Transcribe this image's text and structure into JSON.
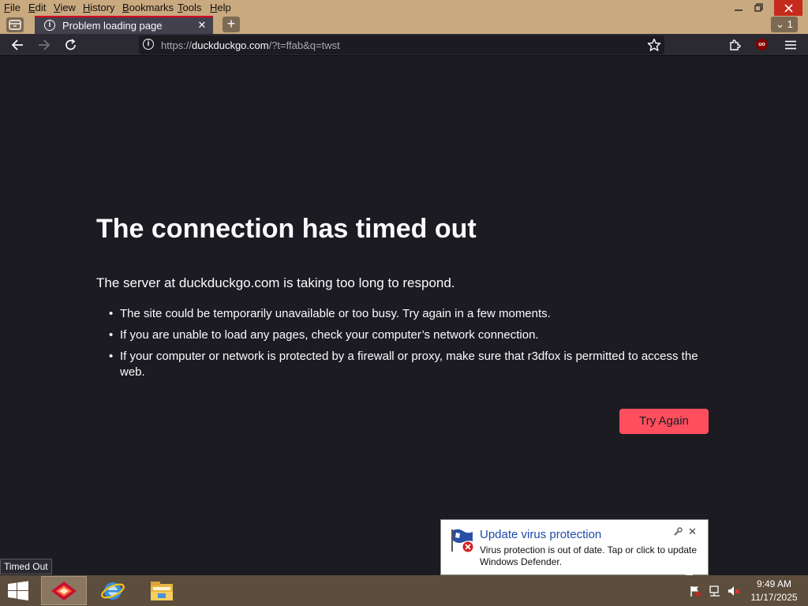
{
  "menubar": {
    "items": [
      "File",
      "Edit",
      "View",
      "History",
      "Bookmarks",
      "Tools",
      "Help"
    ]
  },
  "window_controls": {
    "minimize": "—",
    "restore": "❐",
    "close": "✕"
  },
  "tabstrip": {
    "active_tab_title": "Problem loading page",
    "tab_close": "✕",
    "new_tab": "+",
    "tab_count": "1",
    "tab_list_chevron": "⌄"
  },
  "navbar": {
    "url_scheme": "https://",
    "url_host": "duckduckgo.com",
    "url_rest": "/?t=ffab&q=twst",
    "ublock_label": "uo"
  },
  "error_page": {
    "title": "The connection has timed out",
    "message": "The server at duckduckgo.com is taking too long to respond.",
    "list": [
      "The site could be temporarily unavailable or too busy. Try again in a few moments.",
      "If you are unable to load any pages, check your computer’s network connection.",
      "If your computer or network is protected by a firewall or proxy, make sure that r3dfox is permitted to access the web."
    ],
    "try_again_label": "Try Again"
  },
  "status": {
    "text": "Timed Out"
  },
  "balloon": {
    "title": "Update virus protection",
    "text": "Virus protection is out of date. Tap or click to update Windows Defender.",
    "close": "✕"
  },
  "taskbar": {
    "time": "9:49 AM",
    "date": "11/17/2025"
  },
  "colors": {
    "page_background": "#1c1b22",
    "titlebar": "#c9a97f",
    "try_again_button": "#ff4f5e",
    "tab_accent": "#d70022",
    "taskbar": "#5c4d3c"
  },
  "icons": {
    "back": "arrow-left-icon",
    "forward": "arrow-right-icon",
    "reload": "reload-icon",
    "bookmark": "star-icon",
    "extensions": "puzzle-icon",
    "menu": "hamburger-icon",
    "info": "info-icon",
    "tab_overview": "tab-overview-icon",
    "defender": "defender-flag-icon",
    "start": "windows-logo-icon",
    "firefox_app": "r3dfox-app-icon",
    "ie_app": "internet-explorer-icon",
    "explorer_app": "file-explorer-icon",
    "tray_action_center": "flag-icon",
    "tray_network": "network-icon",
    "tray_volume": "volume-muted-icon"
  }
}
